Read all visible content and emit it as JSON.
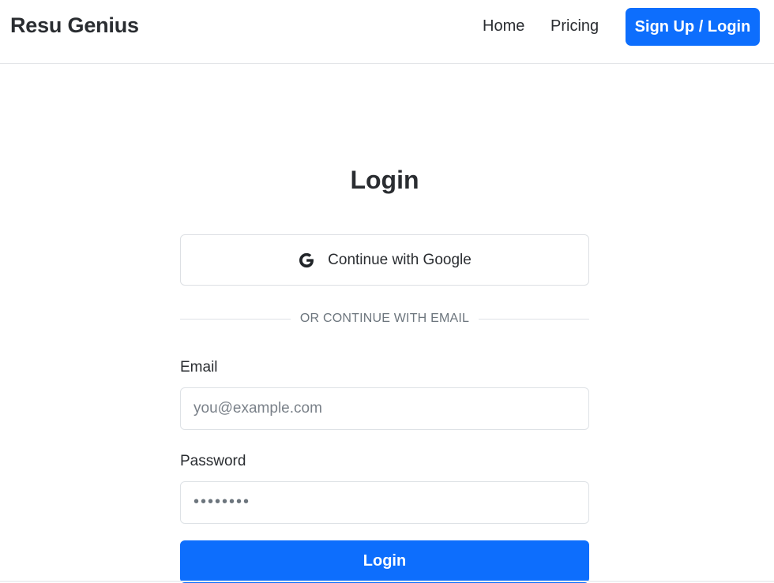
{
  "navbar": {
    "brand": "Resu Genius",
    "links": [
      {
        "label": "Home"
      },
      {
        "label": "Pricing"
      }
    ],
    "cta_label": "Sign Up / Login"
  },
  "login": {
    "title": "Login",
    "google_label": "Continue with Google",
    "google_icon": "google-g-icon",
    "divider_text": "OR CONTINUE WITH EMAIL",
    "email_label": "Email",
    "email_placeholder": "you@example.com",
    "password_label": "Password",
    "password_placeholder": "••••••••",
    "submit_label": "Login"
  },
  "colors": {
    "primary": "#0d6efd",
    "text": "#2a2d31",
    "muted": "#6c757d",
    "border": "#dee2e6"
  }
}
